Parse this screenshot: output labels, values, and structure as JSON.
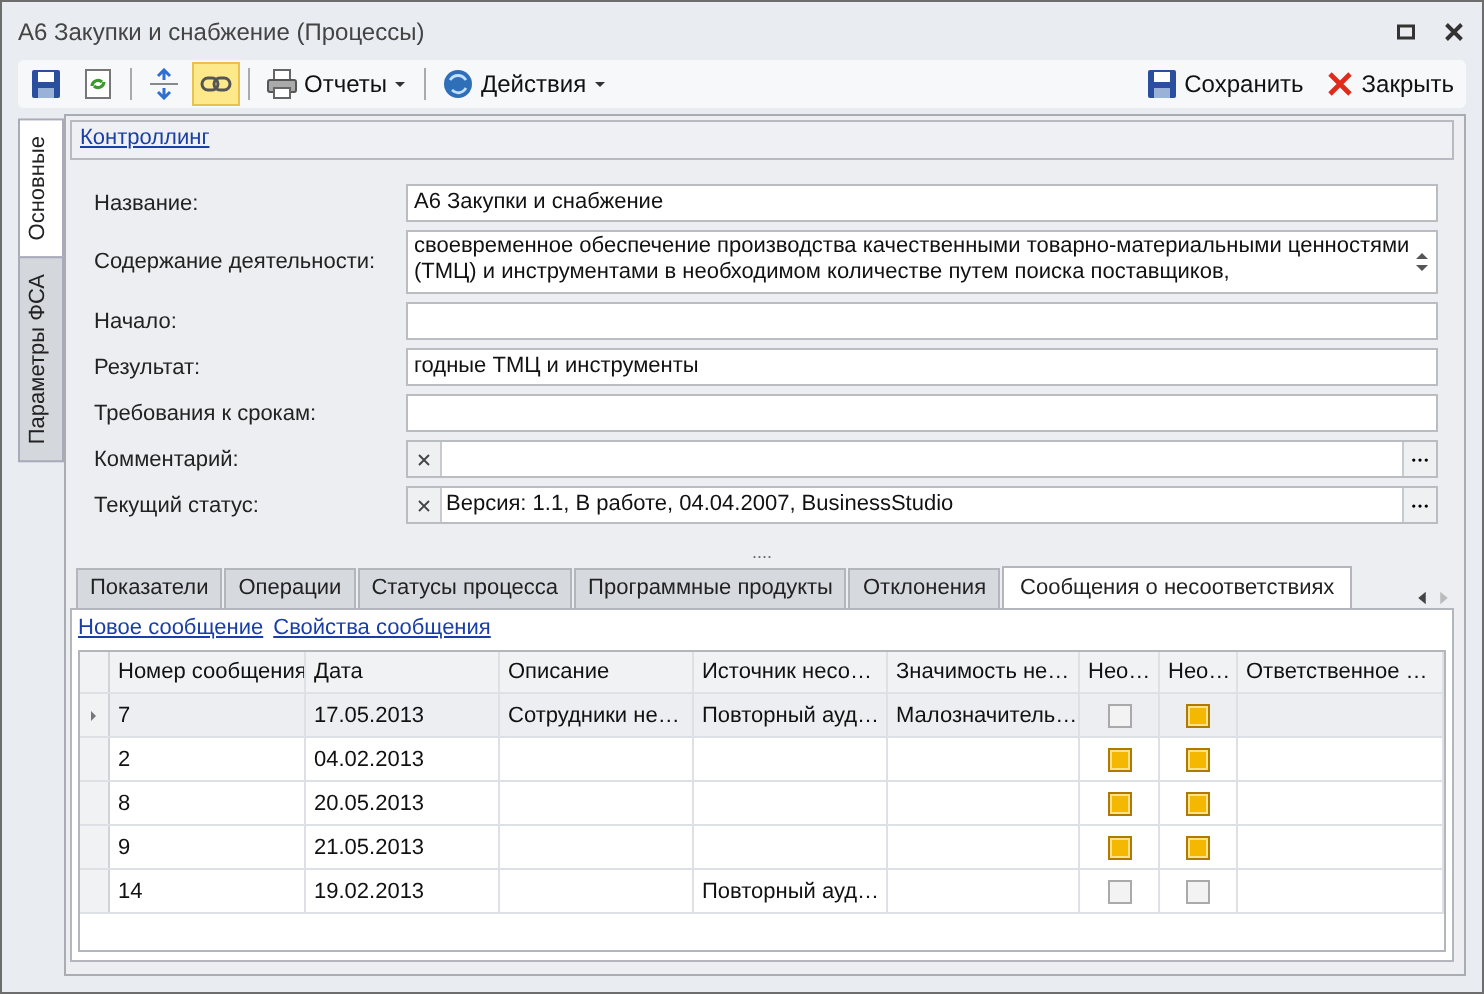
{
  "window": {
    "title": "А6 Закупки и снабжение (Процессы)"
  },
  "toolbar": {
    "icons": [
      {
        "kind": "save",
        "pressed": false
      },
      {
        "kind": "refresh",
        "pressed": false
      },
      {
        "kind": "expand",
        "pressed": false
      },
      {
        "kind": "link",
        "pressed": true
      }
    ],
    "menus": [
      {
        "kind": "printer",
        "label": "Отчеты"
      },
      {
        "kind": "globe",
        "label": "Действия"
      }
    ],
    "actions": [
      {
        "kind": "save",
        "label": "Сохранить"
      },
      {
        "kind": "close",
        "label": "Закрыть"
      }
    ]
  },
  "side_tabs": [
    {
      "label": "Основные",
      "selected": true
    },
    {
      "label": "Параметры ФСА",
      "selected": false
    }
  ],
  "section_link": "Контроллинг",
  "fields": [
    {
      "kind": "text",
      "label": "Название:",
      "value": "А6 Закупки и снабжение"
    },
    {
      "kind": "memo",
      "label": "Содержание деятельности:",
      "value": "своевременное обеспечение производства качественными товарно-материальными ценностями (ТМЦ) и инструментами в необходимом количестве путем поиска поставщиков,"
    },
    {
      "kind": "text",
      "label": "Начало:"
    },
    {
      "kind": "text",
      "label": "Результат:",
      "value": "годные ТМЦ и инструменты"
    },
    {
      "kind": "text",
      "label": "Требования к срокам:"
    },
    {
      "kind": "lookup",
      "label": "Комментарий:"
    },
    {
      "kind": "lookup",
      "label": "Текущий статус:",
      "value": "Версия: 1.1, В работе, 04.04.2007, BusinessStudio"
    }
  ],
  "splitter": "....",
  "tabs": [
    {
      "label": "Показатели",
      "selected": false
    },
    {
      "label": "Операции",
      "selected": false
    },
    {
      "label": "Статусы процесса",
      "selected": false
    },
    {
      "label": "Программные продукты",
      "selected": false
    },
    {
      "label": "Отклонения",
      "selected": false
    },
    {
      "label": "Сообщения о несоответствиях",
      "selected": true
    }
  ],
  "links": [
    "Новое сообщение",
    "Свойства сообщения"
  ],
  "table": {
    "columns": [
      "Номер сообщения",
      "Дата",
      "Описание",
      "Источник несо…",
      "Значимость не…",
      "Нео…",
      "Нео…",
      "Ответственное …"
    ],
    "rows": [
      {
        "selected": true,
        "cells": [
          "7",
          "17.05.2013",
          "Сотрудники не…",
          "Повторный ауд…",
          "Малозначитель…"
        ],
        "checks": [
          false,
          true
        ]
      },
      {
        "selected": false,
        "cells": [
          "2",
          "04.02.2013",
          "",
          "",
          ""
        ],
        "checks": [
          true,
          true
        ]
      },
      {
        "selected": false,
        "cells": [
          "8",
          "20.05.2013",
          "",
          "",
          ""
        ],
        "checks": [
          true,
          true
        ]
      },
      {
        "selected": false,
        "cells": [
          "9",
          "21.05.2013",
          "",
          "",
          ""
        ],
        "checks": [
          true,
          true
        ]
      },
      {
        "selected": false,
        "cells": [
          "14",
          "19.02.2013",
          "",
          "Повторный ауд…",
          ""
        ],
        "checks": [
          false,
          false
        ]
      }
    ]
  }
}
